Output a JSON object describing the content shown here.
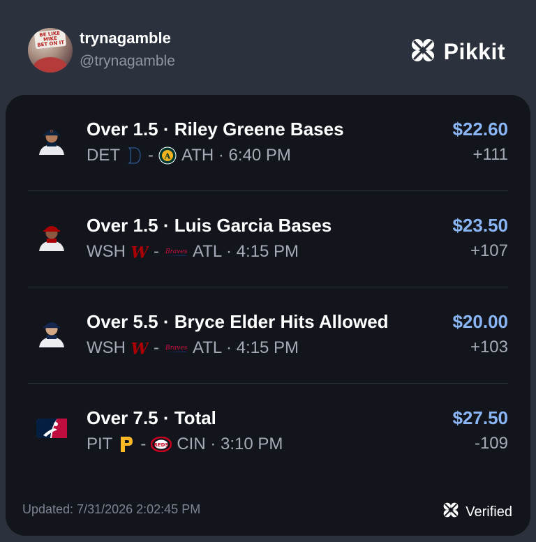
{
  "profile": {
    "username": "trynagamble",
    "handle": "@trynagamble",
    "avatar_sign_text": "BE LIKE MIKE BET ON IT"
  },
  "brand": {
    "name": "Pikkit",
    "icon": "clover-icon"
  },
  "bets": [
    {
      "title": "Over 1.5 · Riley Greene Bases",
      "home": "DET",
      "home_logo": "tigers-logo-icon",
      "away": "ATH · 6:40 PM",
      "away_logo": "athletics-logo-icon",
      "amount": "$22.60",
      "odds": "+111",
      "headshot": "player-headshot-icon"
    },
    {
      "title": "Over 1.5 · Luis Garcia Bases",
      "home": "WSH",
      "home_logo": "nationals-logo-icon",
      "away": "ATL · 4:15 PM",
      "away_logo": "braves-logo-icon",
      "amount": "$23.50",
      "odds": "+107",
      "headshot": "player-headshot-icon"
    },
    {
      "title": "Over 5.5 · Bryce Elder Hits Allowed",
      "home": "WSH",
      "home_logo": "nationals-logo-icon",
      "away": "ATL · 4:15 PM",
      "away_logo": "braves-logo-icon",
      "amount": "$20.00",
      "odds": "+103",
      "headshot": "player-headshot-icon"
    },
    {
      "title": "Over 7.5 · Total",
      "home": "PIT",
      "home_logo": "pirates-logo-icon",
      "away": "CIN · 3:10 PM",
      "away_logo": "reds-logo-icon",
      "amount": "$27.50",
      "odds": "-109",
      "headshot": "mlb-logo-icon"
    }
  ],
  "separator": "-",
  "footer": {
    "updated": "Updated: 7/31/2026 2:02:45 PM",
    "verified": "Verified"
  },
  "colors": {
    "background": "#2b313d",
    "card": "#12151c",
    "amount": "#8ab6f5",
    "muted": "#a5abb6"
  }
}
